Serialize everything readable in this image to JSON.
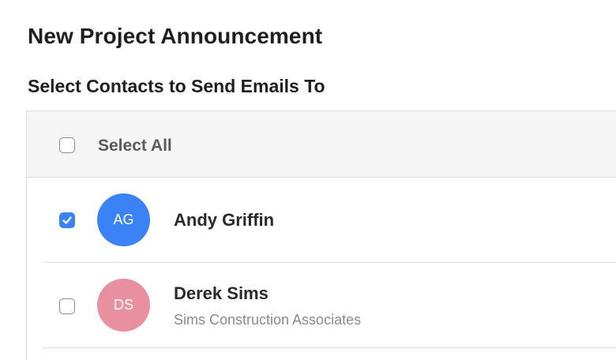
{
  "page": {
    "title": "New Project Announcement",
    "subtitle": "Select Contacts to Send Emails To"
  },
  "select_all": {
    "label": "Select All",
    "checked": false
  },
  "contacts": [
    {
      "initials": "AG",
      "name": "Andy Griffin",
      "company": "",
      "checked": true,
      "avatar_color": "#3b82f6"
    },
    {
      "initials": "DS",
      "name": "Derek Sims",
      "company": "Sims Construction Associates",
      "checked": false,
      "avatar_color": "#e890a0"
    }
  ],
  "colors": {
    "accent": "#3b82f6",
    "header_bg": "#f5f5f6",
    "divider": "#dcdcdc"
  }
}
